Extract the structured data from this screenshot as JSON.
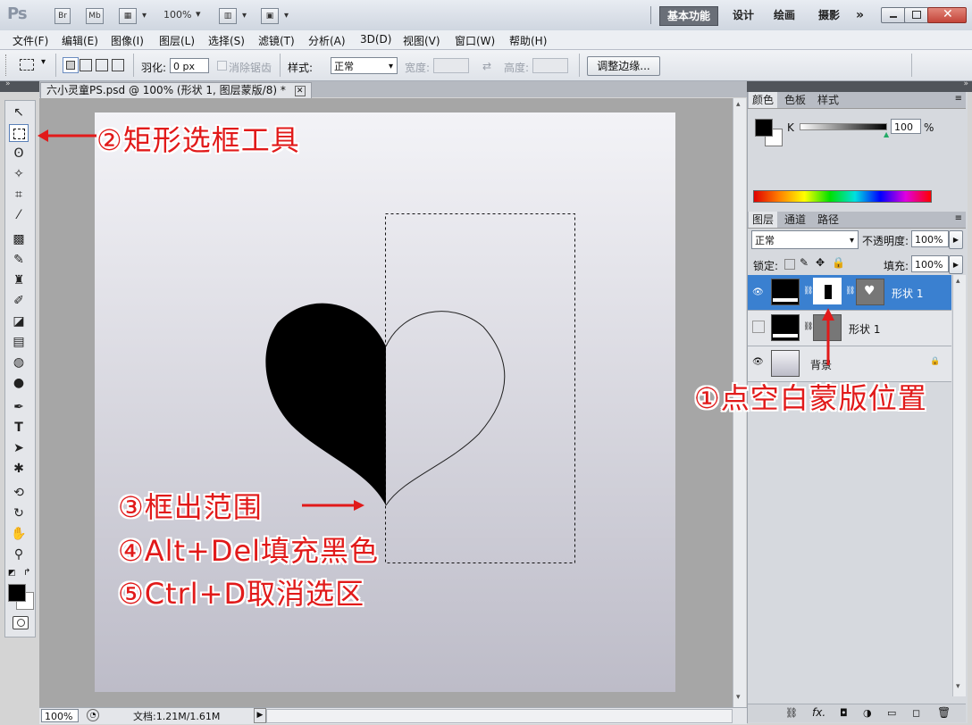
{
  "app": {
    "logo": "Ps",
    "bridge_label": "Br",
    "minibridge_label": "Mb",
    "zoom": "100%",
    "workspaces": [
      "基本功能",
      "设计",
      "绘画",
      "摄影"
    ],
    "more": "»"
  },
  "menus": [
    "文件(F)",
    "编辑(E)",
    "图像(I)",
    "图层(L)",
    "选择(S)",
    "滤镜(T)",
    "分析(A)",
    "3D(D)",
    "视图(V)",
    "窗口(W)",
    "帮助(H)"
  ],
  "options": {
    "feather_label": "羽化:",
    "feather_value": "0 px",
    "antialias_label": "消除锯齿",
    "style_label": "样式:",
    "style_value": "正常",
    "width_label": "宽度:",
    "height_label": "高度:",
    "refine_edge": "调整边缘..."
  },
  "document": {
    "tab_title": "六小灵童PS.psd @ 100% (形状 1, 图层蒙版/8) *",
    "zoom": "100%",
    "doc_size": "文档:1.21M/1.61M"
  },
  "annotations": {
    "step1": "①点空白蒙版位置",
    "step2": "②矩形选框工具",
    "step3": "③框出范围",
    "step4": "④Alt+Del填充黑色",
    "step5": "⑤Ctrl+D取消选区",
    "color": "#e11a1a"
  },
  "color_panel": {
    "tabs": [
      "颜色",
      "色板",
      "样式"
    ],
    "channel": "K",
    "value": "100",
    "unit": "%",
    "k_level": 1.0
  },
  "layers_panel": {
    "tabs": [
      "图层",
      "通道",
      "路径"
    ],
    "blend_mode": "正常",
    "opacity_label": "不透明度:",
    "opacity_value": "100%",
    "lock_label": "锁定:",
    "fill_label": "填充:",
    "fill_value": "100%",
    "layers": [
      {
        "name": "形状 1",
        "selected": true,
        "visible": true
      },
      {
        "name": "形状 1",
        "selected": false,
        "visible": false
      },
      {
        "name": "背景",
        "selected": false,
        "visible": true
      }
    ]
  }
}
